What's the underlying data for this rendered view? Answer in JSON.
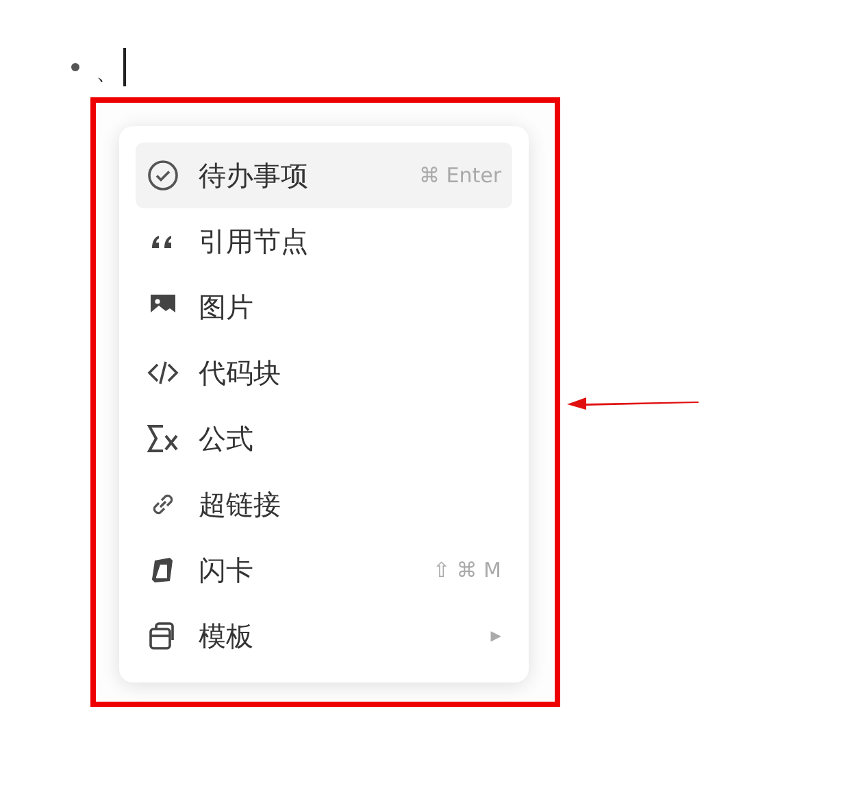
{
  "editor_line": {
    "text": "、"
  },
  "menu": {
    "items": [
      {
        "label": "待办事项",
        "shortcut": "⌘ Enter",
        "selected": true
      },
      {
        "label": "引用节点",
        "selected": false
      },
      {
        "label": "图片",
        "selected": false
      },
      {
        "label": "代码块",
        "selected": false
      },
      {
        "label": "公式",
        "selected": false
      },
      {
        "label": "超链接",
        "selected": false
      },
      {
        "label": "闪卡",
        "shortcut": "⇧ ⌘ M",
        "selected": false
      },
      {
        "label": "模板",
        "submenu": "▶",
        "selected": false
      }
    ]
  }
}
